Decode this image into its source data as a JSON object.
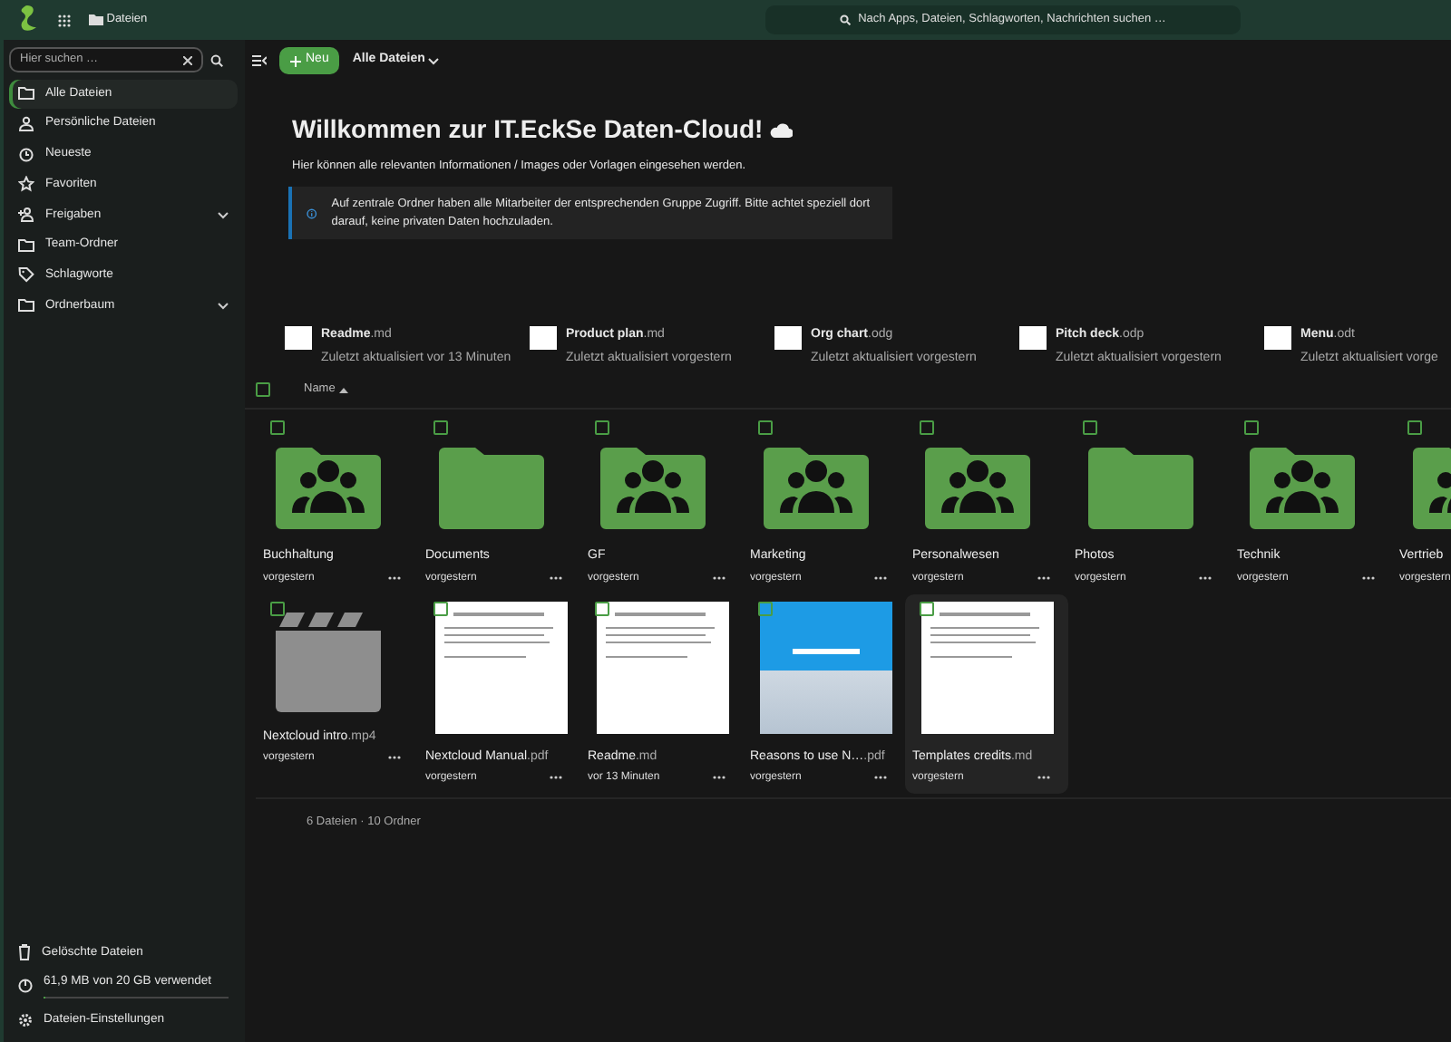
{
  "header": {
    "app_title": "Dateien",
    "search_placeholder": "Nach Apps, Dateien, Schlagworten, Nachrichten suchen …"
  },
  "sidebar": {
    "search_placeholder": "Hier suchen …",
    "items": [
      {
        "label": "Alle Dateien",
        "kind": "folder",
        "selected": true,
        "expandable": false
      },
      {
        "label": "Persönliche Dateien",
        "kind": "person",
        "selected": false,
        "expandable": false
      },
      {
        "label": "Neueste",
        "kind": "clock",
        "selected": false,
        "expandable": false
      },
      {
        "label": "Favoriten",
        "kind": "star",
        "selected": false,
        "expandable": false
      },
      {
        "label": "Freigaben",
        "kind": "share",
        "selected": false,
        "expandable": true
      },
      {
        "label": "Team-Ordner",
        "kind": "folder",
        "selected": false,
        "expandable": false
      },
      {
        "label": "Schlagworte",
        "kind": "tag",
        "selected": false,
        "expandable": false
      },
      {
        "label": "Ordnerbaum",
        "kind": "folder",
        "selected": false,
        "expandable": true
      }
    ],
    "trash": "Gelöschte Dateien",
    "quota": {
      "text": "61,9 MB von 20 GB verwendet",
      "level": 0.003
    },
    "settings": "Dateien-Einstellungen"
  },
  "toolbar": {
    "new_button": "Neu",
    "breadcrumb": "Alle Dateien"
  },
  "welcome": {
    "title": "Willkommen zur IT.EckSe Daten-Cloud!",
    "subtitle": "Hier können alle relevanten Informationen / Images oder Vorlagen eingesehen werden.",
    "note": "Auf zentrale Ordner haben alle Mitarbeiter der entsprechenden Gruppe Zugriff. Bitte achtet speziell dort darauf, keine privaten Daten hochzuladen."
  },
  "recent": [
    {
      "name": "Readme",
      "ext": ".md",
      "subtitle": "Zuletzt aktualisiert vor 13 Minuten"
    },
    {
      "name": "Product plan",
      "ext": ".md",
      "subtitle": "Zuletzt aktualisiert vorgestern"
    },
    {
      "name": "Org chart",
      "ext": ".odg",
      "subtitle": "Zuletzt aktualisiert vorgestern"
    },
    {
      "name": "Pitch deck",
      "ext": ".odp",
      "subtitle": "Zuletzt aktualisiert vorgestern"
    },
    {
      "name": "Menu",
      "ext": ".odt",
      "subtitle": "Zuletzt aktualisiert vorge"
    }
  ],
  "list_header": {
    "column": "Name",
    "sorted_ascending": true,
    "all_selected": false
  },
  "files": [
    {
      "kind": "team-folder",
      "name": "Buchhaltung",
      "date": "vorgestern",
      "selected": false,
      "highlighted": false
    },
    {
      "kind": "folder",
      "name": "Documents",
      "date": "vorgestern",
      "selected": false,
      "highlighted": false
    },
    {
      "kind": "team-folder",
      "name": "GF",
      "date": "vorgestern",
      "selected": false,
      "highlighted": false
    },
    {
      "kind": "team-folder",
      "name": "Marketing",
      "date": "vorgestern",
      "selected": false,
      "highlighted": false
    },
    {
      "kind": "team-folder",
      "name": "Personalwesen",
      "date": "vorgestern",
      "selected": false,
      "highlighted": false
    },
    {
      "kind": "folder",
      "name": "Photos",
      "date": "vorgestern",
      "selected": false,
      "highlighted": false
    },
    {
      "kind": "team-folder",
      "name": "Technik",
      "date": "vorgestern",
      "selected": false,
      "highlighted": false
    },
    {
      "kind": "team-folder",
      "name": "Vertrieb",
      "date": "vorgestern",
      "selected": false,
      "highlighted": false
    },
    {
      "kind": "video",
      "name": "Nextcloud intro",
      "ext": ".mp4",
      "date": "vorgestern",
      "selected": false,
      "highlighted": false
    },
    {
      "kind": "document",
      "name": "Nextcloud Manual",
      "ext": ".pdf",
      "date": "vorgestern",
      "selected": false,
      "highlighted": false
    },
    {
      "kind": "document",
      "name": "Readme",
      "ext": ".md",
      "date": "vor 13 Minuten",
      "selected": false,
      "highlighted": false
    },
    {
      "kind": "slides",
      "name": "Reasons to use N…",
      "ext": ".pdf",
      "date": "vorgestern",
      "selected": false,
      "highlighted": false
    },
    {
      "kind": "document",
      "name": "Templates credits",
      "ext": ".md",
      "date": "vorgestern",
      "selected": false,
      "highlighted": true
    }
  ],
  "summary": "6 Dateien · 10 Ordner"
}
